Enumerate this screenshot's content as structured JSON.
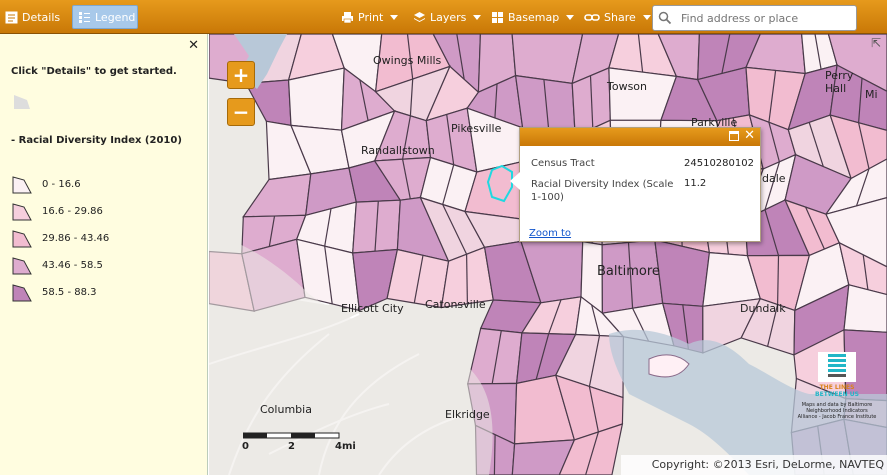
{
  "toolbar": {
    "details_label": "Details",
    "legend_label": "Legend",
    "print_label": "Print",
    "layers_label": "Layers",
    "basemap_label": "Basemap",
    "share_label": "Share",
    "search_placeholder": "Find address or place"
  },
  "panel": {
    "close_glyph": "✕",
    "intro_text": "Click \"Details\" to get started.",
    "legend_title": "- Racial Diversity Index (2010)",
    "legend_items": [
      {
        "label": "0 - 16.6",
        "color": "#fbf1f4"
      },
      {
        "label": "16.6 - 29.86",
        "color": "#f6cfdd"
      },
      {
        "label": "29.86 - 43.46",
        "color": "#f2bcd0"
      },
      {
        "label": "43.46 - 58.5",
        "color": "#deaccf"
      },
      {
        "label": "58.5 - 88.3",
        "color": "#bf84b8"
      }
    ]
  },
  "map": {
    "zoom_in": "+",
    "zoom_out": "−",
    "places": [
      "Owings Mills",
      "Towson",
      "Perry Hall",
      "Mi",
      "Pikesville",
      "Randallstown",
      "Parkville",
      "dale",
      "Baltimore",
      "Ellicott City",
      "Catonsville",
      "Dundalk",
      "Columbia",
      "Elkridge"
    ],
    "scale_labels": [
      "0",
      "2",
      "4mi"
    ],
    "copyright": "Copyright: ©2013 Esri, DeLorme, NAVTEQ"
  },
  "popup": {
    "field1_label": "Census Tract",
    "field1_value": "24510280102",
    "field2_label": "Racial Diversity Index (Scale 1-100)",
    "field2_value": "11.2",
    "link": "Zoom to"
  },
  "logo": {
    "line1": "THE LINES",
    "line2": "BETWEEN US",
    "line3": "Maps and data by Baltimore Neighborhood Indicators Alliance - Jacob France Institute"
  },
  "colors": {
    "accent": "#e69a1c",
    "accent_dark": "#c97807",
    "panel_bg": "#fffde0",
    "link": "#1155cc"
  }
}
